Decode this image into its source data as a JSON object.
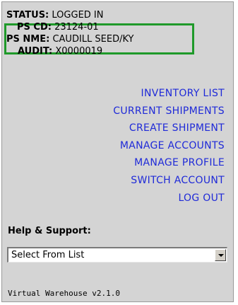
{
  "status": {
    "status_label": "STATUS:",
    "status_value": "LOGGED IN",
    "ps_cd_label": "PS CD:",
    "ps_cd_value": "23124-01",
    "ps_nme_label": "PS NME:",
    "ps_nme_value": "CAUDILL SEED/KY",
    "audit_label": "AUDIT:",
    "audit_value": "X0000019"
  },
  "menu": {
    "items": [
      "INVENTORY LIST",
      "CURRENT SHIPMENTS",
      "CREATE SHIPMENT",
      "MANAGE ACCOUNTS",
      "MANAGE PROFILE",
      "SWITCH ACCOUNT",
      "LOG OUT"
    ]
  },
  "help": {
    "title": "Help & Support:",
    "select_value": "Select From List"
  },
  "footer": {
    "version": "Virtual Warehouse v2.1.0"
  },
  "colors": {
    "link": "#1f2ad8",
    "highlight": "#1f9a2a",
    "panel": "#d4d4d4"
  }
}
